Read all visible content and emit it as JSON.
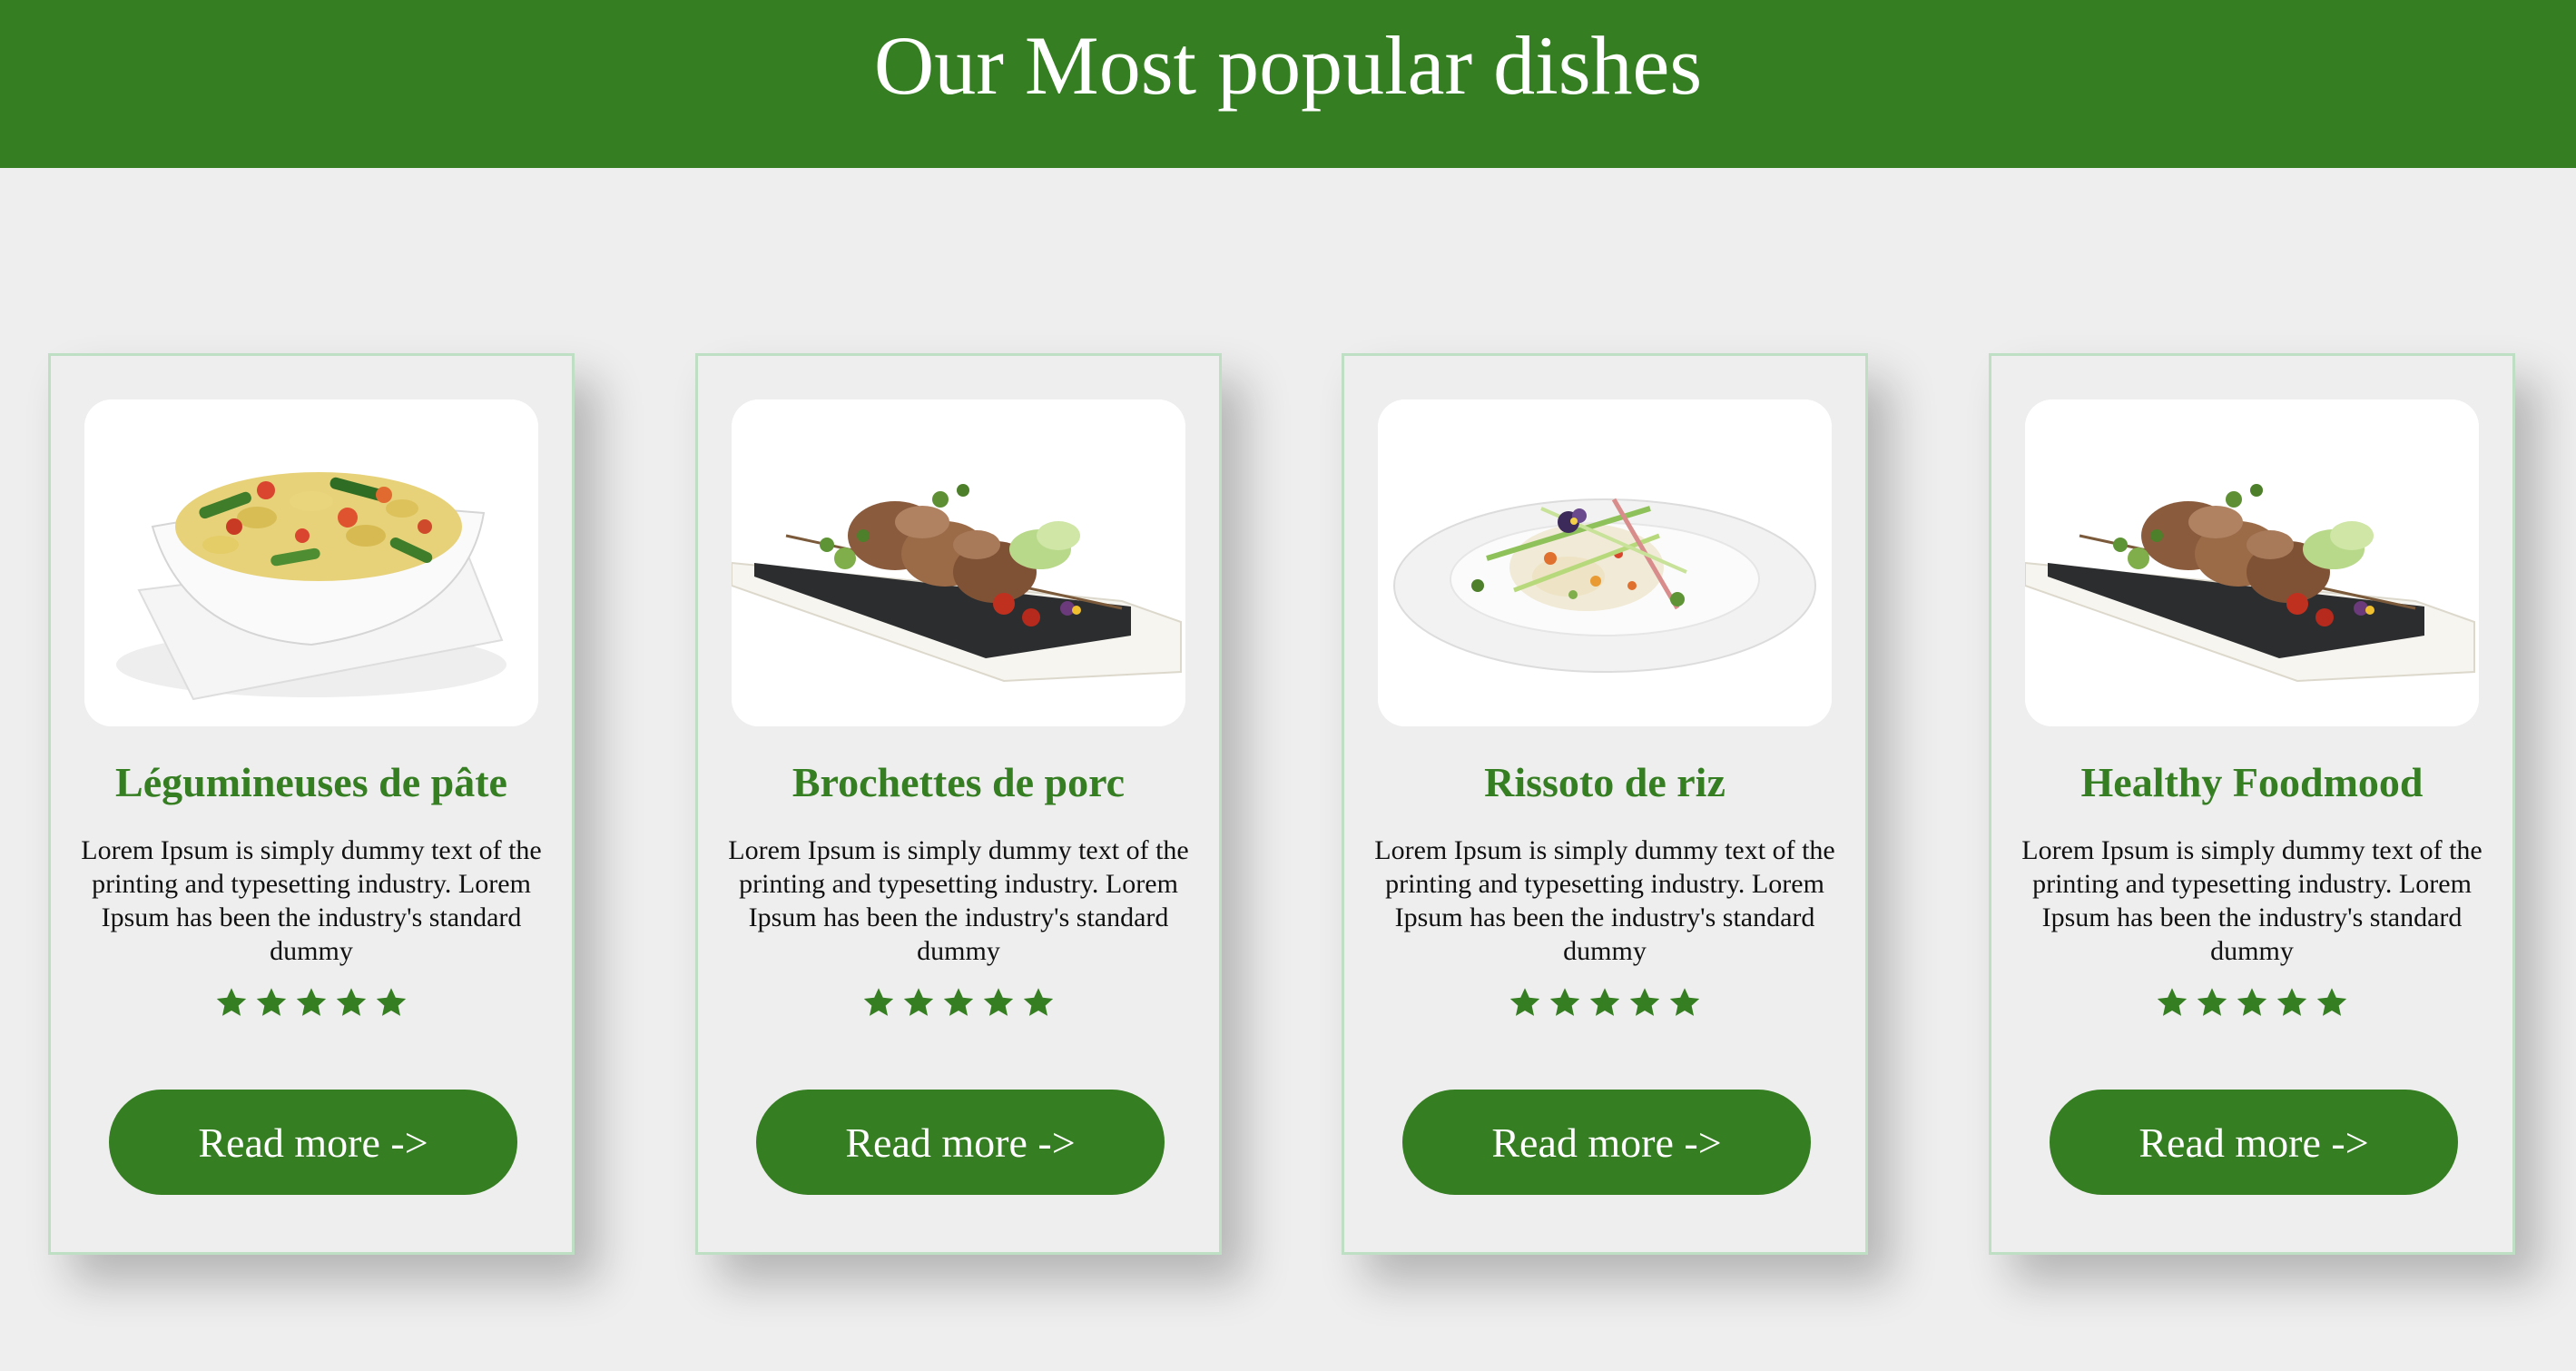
{
  "header": {
    "title": "Our Most popular dishes",
    "background_color": "#367e22"
  },
  "dishes": [
    {
      "title": "Légumineuses de pâte",
      "description": "Lorem Ipsum is simply dummy text of the printing and typesetting industry. Lorem Ipsum has been the industry's standard dummy",
      "rating": 5,
      "image": "pasta-salad-bowl",
      "button_label": "Read more ->"
    },
    {
      "title": "Brochettes de porc",
      "description": "Lorem Ipsum is simply dummy text of the printing and typesetting industry. Lorem Ipsum has been the industry's standard dummy",
      "rating": 5,
      "image": "pork-skewers-plate",
      "button_label": "Read more ->"
    },
    {
      "title": "Rissoto de riz",
      "description": "Lorem Ipsum is simply dummy text of the printing and typesetting industry. Lorem Ipsum has been the industry's standard dummy",
      "rating": 5,
      "image": "rice-risotto-plate",
      "button_label": "Read more ->"
    },
    {
      "title": "Healthy Foodmood",
      "description": "Lorem Ipsum is simply dummy text of the printing and typesetting industry. Lorem Ipsum has been the industry's standard dummy",
      "rating": 5,
      "image": "pork-skewers-plate",
      "button_label": "Read more ->"
    }
  ],
  "colors": {
    "accent": "#367e22",
    "page_background": "#eeeeee",
    "card_border": "#bfdfc4",
    "button_text": "#ffffff"
  }
}
